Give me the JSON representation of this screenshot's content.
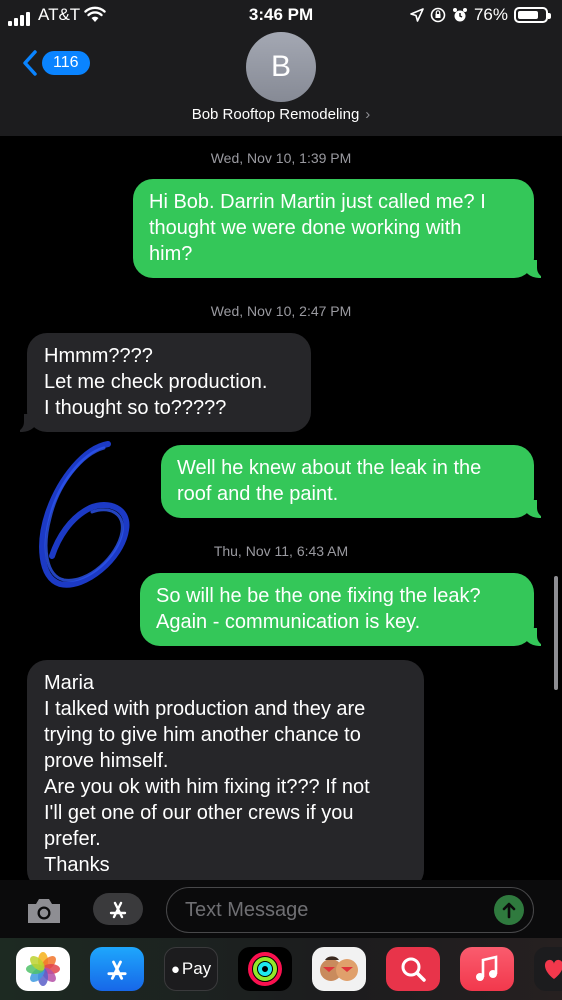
{
  "status": {
    "carrier": "AT&T",
    "time": "3:46 PM",
    "battery": "76%",
    "battery_level": 0.76
  },
  "header": {
    "back_count": "116",
    "avatar_letter": "B",
    "contact_name": "Bob Rooftop Remodeling"
  },
  "messages": [
    {
      "timestamp": "Wed, Nov 10, 1:39 PM"
    },
    {
      "from": "me",
      "lines": [
        "Hi Bob. Darrin Martin just called me? I",
        "thought we were done working with",
        "him?"
      ]
    },
    {
      "timestamp": "Wed, Nov 10, 2:47 PM"
    },
    {
      "from": "contact",
      "lines": [
        "Hmmm????",
        "Let me check production.",
        "I thought so to?????"
      ]
    },
    {
      "from": "me",
      "lines": [
        "Well he knew about the leak in the",
        "roof and the paint."
      ]
    },
    {
      "timestamp": "Thu, Nov 11, 6:43 AM"
    },
    {
      "from": "me",
      "lines": [
        "So will he be the one fixing the leak?",
        "Again - communication is key."
      ]
    },
    {
      "from": "contact",
      "lines": [
        "Maria",
        "I talked with production and they are",
        "trying to give him another chance to",
        "prove himself.",
        "Are you ok with him fixing it??? If not",
        "I'll get one of our other crews if you",
        "prefer.",
        "Thanks"
      ]
    }
  ],
  "composer": {
    "placeholder": "Text Message"
  },
  "dock": {
    "apps": [
      {
        "name": "photos-app-icon"
      },
      {
        "name": "app-store-icon"
      },
      {
        "name": "apple-pay-icon",
        "label": "Pay"
      },
      {
        "name": "activity-icon"
      },
      {
        "name": "memoji-icon"
      },
      {
        "name": "search-images-icon"
      },
      {
        "name": "music-icon"
      },
      {
        "name": "digital-touch-icon"
      }
    ]
  },
  "colors": {
    "sent_bubble": "#34c759",
    "received_bubble": "#262629",
    "accent": "#0a84ff",
    "annotation": "#1e3fd6"
  }
}
